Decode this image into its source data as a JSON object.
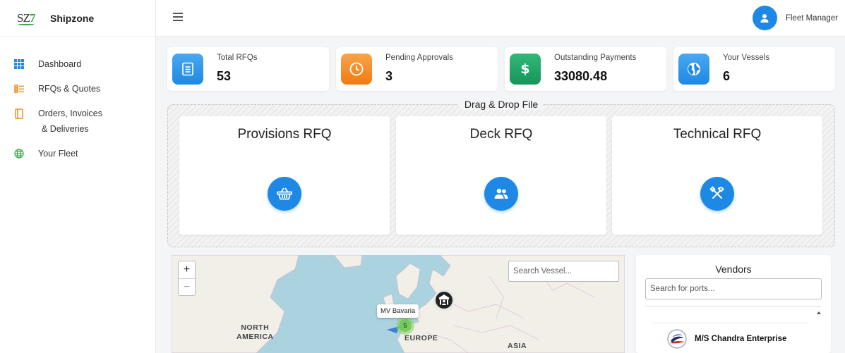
{
  "brand": {
    "logo_text": "SZ",
    "logo_accent": "7",
    "name": "Shipzone"
  },
  "sidebar": {
    "items": [
      {
        "label": "Dashboard",
        "icon": "grid-icon"
      },
      {
        "label": "RFQs & Quotes",
        "icon": "list-icon"
      },
      {
        "label": "Orders, Invoices",
        "label2": "& Deliveries",
        "icon": "document-icon"
      },
      {
        "label": "Your Fleet",
        "icon": "globe-icon"
      }
    ]
  },
  "topbar": {
    "user_name": "Fleet Manager"
  },
  "stats": [
    {
      "label": "Total RFQs",
      "value": "53",
      "icon": "document-icon",
      "color": "#1e88e5"
    },
    {
      "label": "Pending Approvals",
      "value": "3",
      "icon": "clock-icon",
      "color": "#f5861f"
    },
    {
      "label": "Outstanding Payments",
      "value": "33080.48",
      "icon": "dollar-icon",
      "color": "#1fa463"
    },
    {
      "label": "Your Vessels",
      "value": "6",
      "icon": "globe-icon",
      "color": "#1e88e5"
    }
  ],
  "dropzone": {
    "title": "Drag & Drop File",
    "cards": [
      {
        "title": "Provisions RFQ",
        "icon": "basket-icon"
      },
      {
        "title": "Deck RFQ",
        "icon": "users-icon"
      },
      {
        "title": "Technical RFQ",
        "icon": "tools-icon"
      }
    ]
  },
  "map": {
    "zoom_in": "+",
    "zoom_out": "−",
    "search_placeholder": "Search Vessel...",
    "labels": {
      "north_america_1": "NORTH",
      "north_america_2": "AMERICA",
      "europe": "EUROPE",
      "asia": "ASIA"
    },
    "vessel_tooltip": "MV Bavaria",
    "cluster_count": "5"
  },
  "vendors": {
    "title": "Vendors",
    "search_placeholder": "Search for ports...",
    "items": [
      {
        "name": "M/S Chandra Enterprise"
      }
    ]
  },
  "colors": {
    "accent": "#1e88e5",
    "orange": "#f5861f",
    "green": "#1fa463"
  }
}
